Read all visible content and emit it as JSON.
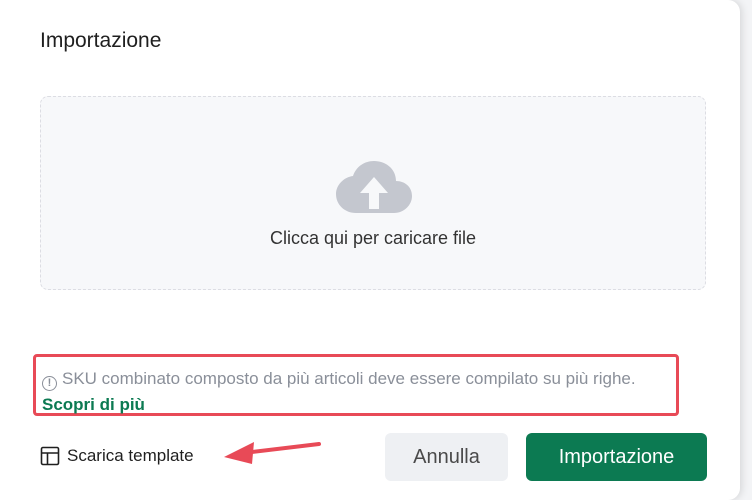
{
  "dialog": {
    "title": "Importazione"
  },
  "upload": {
    "icon": "cloud-upload-icon",
    "label": "Clicca qui per caricare file"
  },
  "notice": {
    "icon": "info-circle-icon",
    "text": "SKU combinato composto da più articoli deve essere compilato su più righe.",
    "link_label": "Scopri di più",
    "highlight_color": "#e84a57"
  },
  "footer": {
    "template_icon": "layout-template-icon",
    "template_label": "Scarica template",
    "cancel_label": "Annulla",
    "import_label": "Importazione"
  },
  "colors": {
    "primary": "#0c7a52",
    "annotation": "#e84a57"
  }
}
